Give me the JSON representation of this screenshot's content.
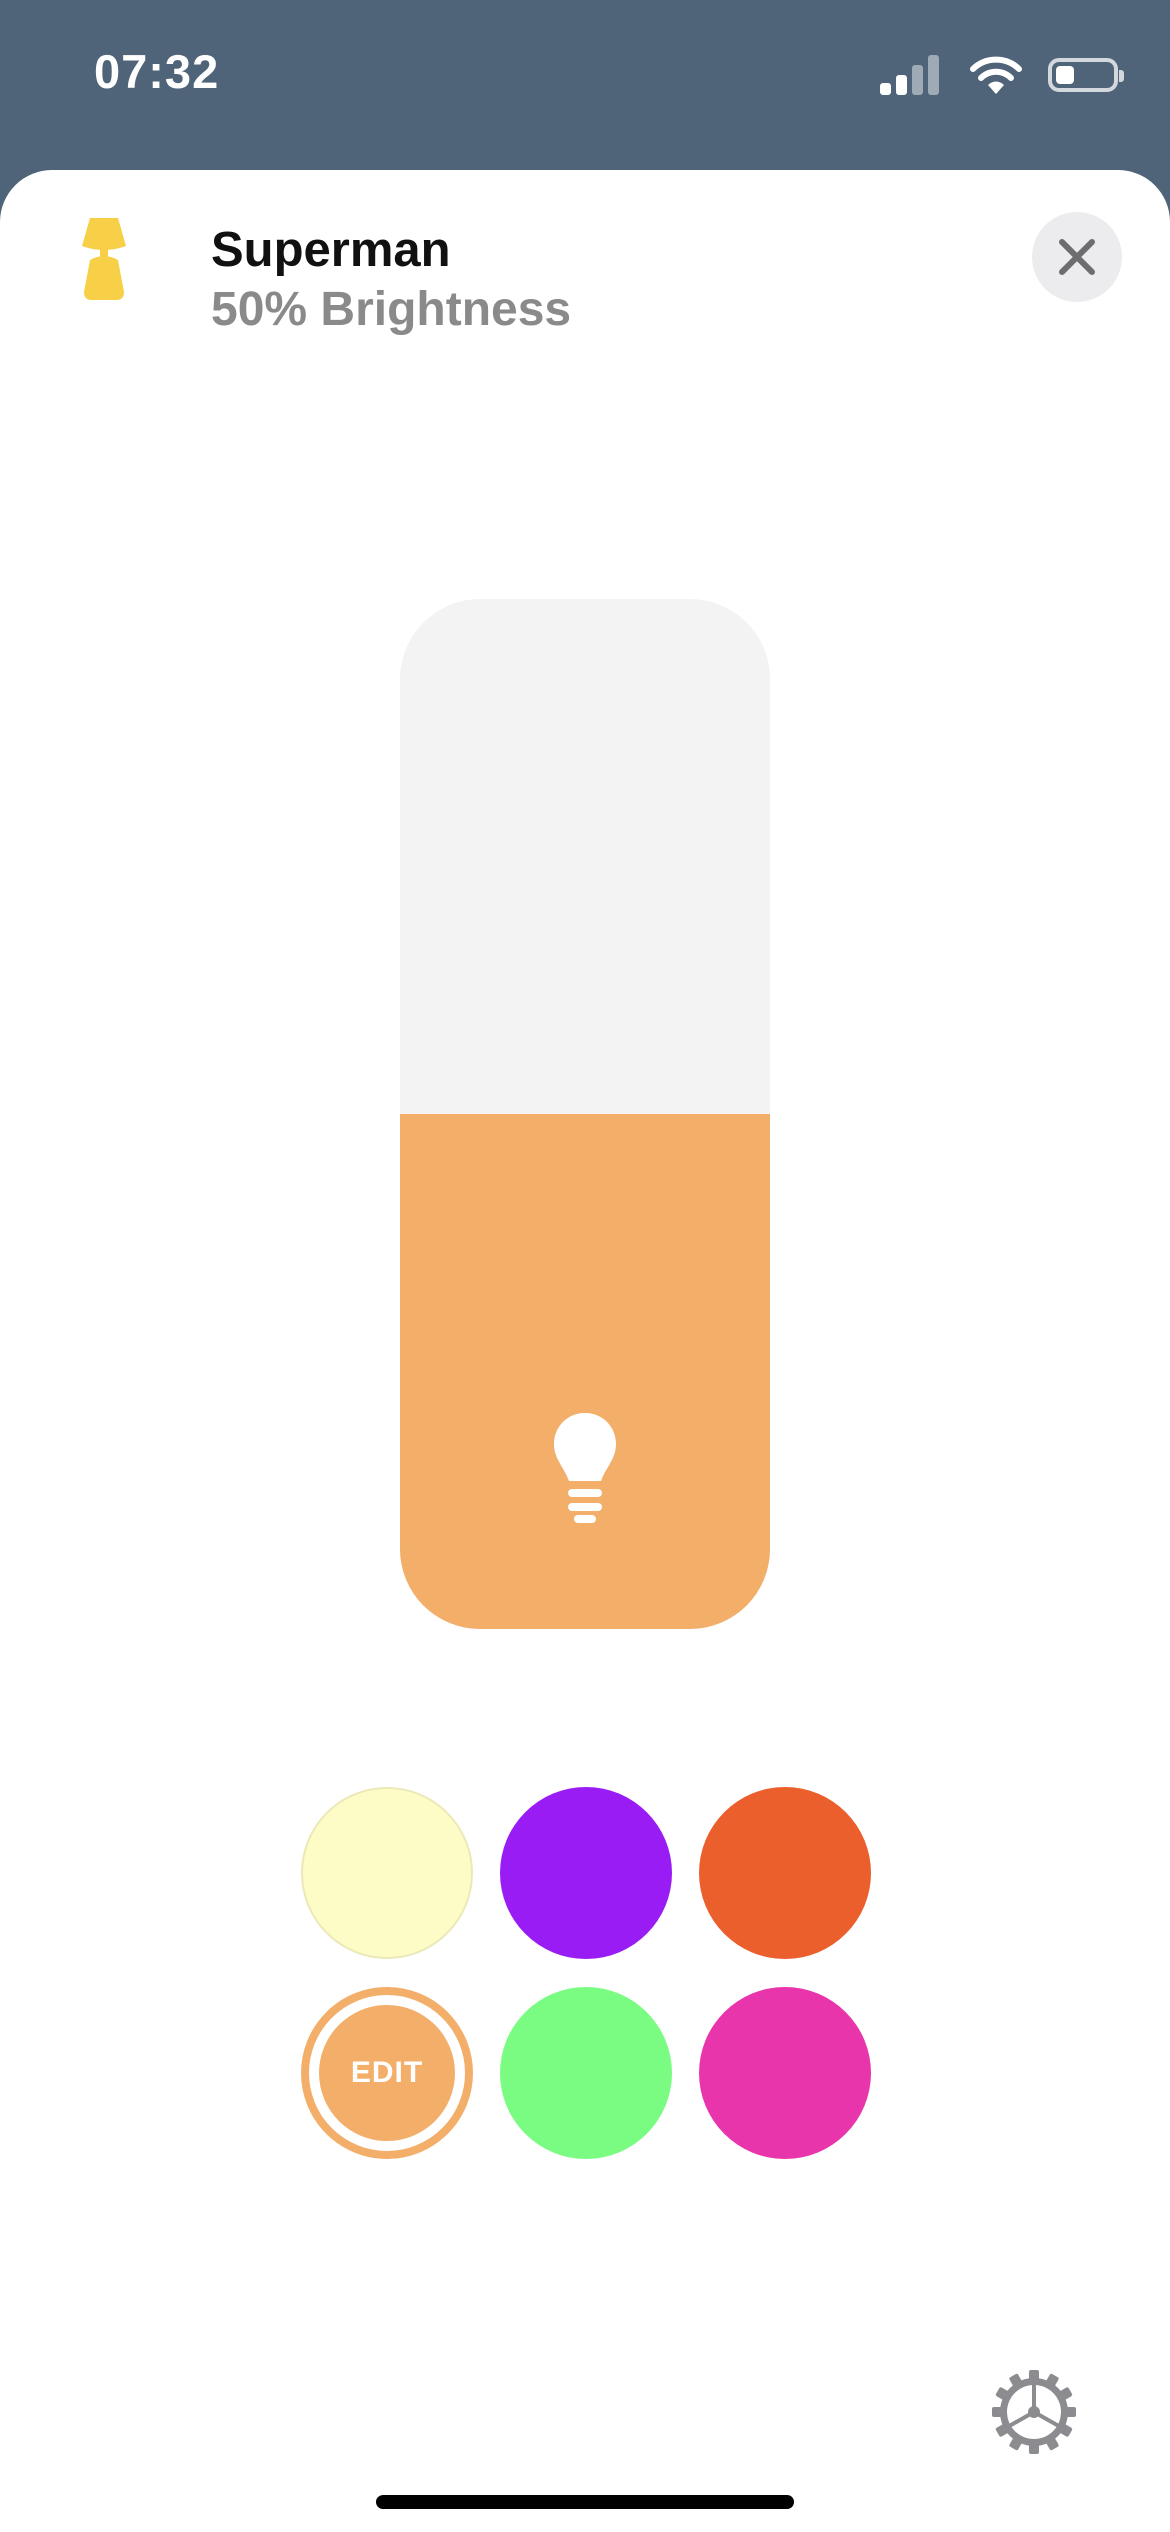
{
  "status_bar": {
    "time": "07:32"
  },
  "header": {
    "title": "Superman",
    "subtitle": "50% Brightness"
  },
  "brightness": {
    "level": 0.5,
    "fill_color": "#f3ae6a",
    "track_color": "#f3f3f3",
    "icon": "lightbulb-icon"
  },
  "swatches": [
    {
      "color": "#fdfcc6",
      "label": ""
    },
    {
      "color": "#9a1cf5",
      "label": ""
    },
    {
      "color": "#ea5f2c",
      "label": ""
    },
    {
      "color": "#f3ae6a",
      "label": "EDIT",
      "selected": true
    },
    {
      "color": "#7afc83",
      "label": ""
    },
    {
      "color": "#e935ac",
      "label": ""
    }
  ],
  "colors": {
    "status_background": "#4f6479",
    "accent": "#f3ae6a",
    "lamp": "#f8d048"
  },
  "icons": {
    "lamp": "lamp-icon",
    "close": "close-icon",
    "settings": "gear-icon"
  }
}
